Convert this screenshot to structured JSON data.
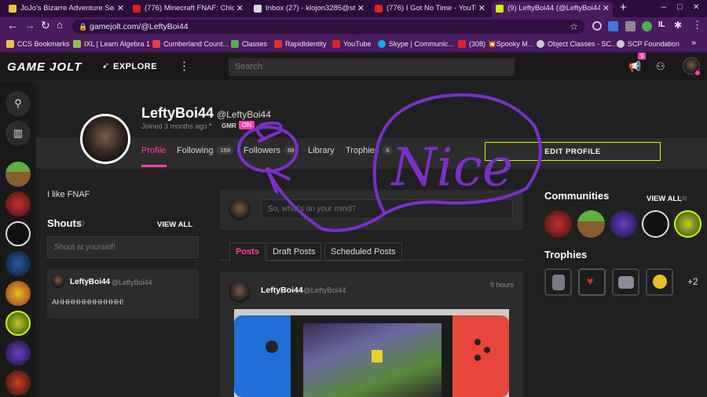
{
  "browser": {
    "tabs": [
      {
        "title": "JoJo's Bizarre Adventure Seaso",
        "color": "#e8c840"
      },
      {
        "title": "(776) Minecraft FNAF: Chica is",
        "color": "#e02020"
      },
      {
        "title": "Inbox (27) - klojon3285@studen",
        "color": "#d8d8d8"
      },
      {
        "title": "(776) I Got No Time - YouTube",
        "color": "#e02020"
      },
      {
        "title": "(9) LeftyBoi44 (@LeftyBoi44) - G",
        "color": "#ccff00"
      }
    ],
    "new_tab": "+",
    "window": {
      "minimize": "–",
      "maximize": "□",
      "close": "✕"
    },
    "url": "gamejolt.com/@LeftyBoi44",
    "ext_badge": "IL",
    "bookmarks": [
      {
        "label": "CCS Bookmarks",
        "color": "#e8c840"
      },
      {
        "label": "IXL | Learn Algebra 1",
        "color": "#8bc34a"
      },
      {
        "label": "Cumberland Count...",
        "color": "#e04040"
      },
      {
        "label": "Classes",
        "color": "#4caf50"
      },
      {
        "label": "RapidIdentity",
        "color": "#e03030"
      },
      {
        "label": "YouTube",
        "color": "#e02020"
      },
      {
        "label": "Skype | Communic...",
        "color": "#00aff0"
      },
      {
        "label": "(308) 💥Spooky M...",
        "color": "#e02020"
      },
      {
        "label": "Object Classes - SC...",
        "color": "#cccccc"
      },
      {
        "label": "SCP Foundation",
        "color": "#cccccc"
      }
    ],
    "more_bookmarks": "»"
  },
  "site": {
    "logo": "GAME JOLT",
    "explore": "EXPLORE",
    "search_placeholder": "Search",
    "notification_count": "9"
  },
  "profile": {
    "display_name": "LeftyBoi44",
    "username": "@LeftyBoi44",
    "joined": "Joined 3 months ago",
    "badge_gmr": "GMR",
    "badge_online": "ON",
    "tabs": [
      {
        "label": "Profile"
      },
      {
        "label": "Following",
        "count": "159"
      },
      {
        "label": "Followers",
        "count": "69"
      },
      {
        "label": "Library"
      },
      {
        "label": "Trophies",
        "count": "6"
      }
    ],
    "edit_button": "EDIT PROFILE",
    "bio": "I like FNAF"
  },
  "shouts": {
    "title": "Shouts",
    "count": "(1)",
    "view_all": "VIEW ALL",
    "placeholder": "Shout at yourself!",
    "items": [
      {
        "name": "LeftyBoi44",
        "handle": "@LeftyBoi44",
        "text": "AHHHHHHHHHHHH!"
      }
    ]
  },
  "feed": {
    "compose_placeholder": "So, what's on your mind?",
    "tabs": [
      "Posts",
      "Draft Posts",
      "Scheduled Posts"
    ],
    "post": {
      "name": "LeftyBoi44",
      "handle": "@LeftyBoi44",
      "time": "9 hours"
    }
  },
  "communities": {
    "title": "Communities",
    "view_all": "VIEW ALL",
    "count": "(6)"
  },
  "trophies": {
    "title": "Trophies",
    "more": "+2"
  },
  "annotation": {
    "text": "Nice",
    "color": "#7b2fc9"
  }
}
